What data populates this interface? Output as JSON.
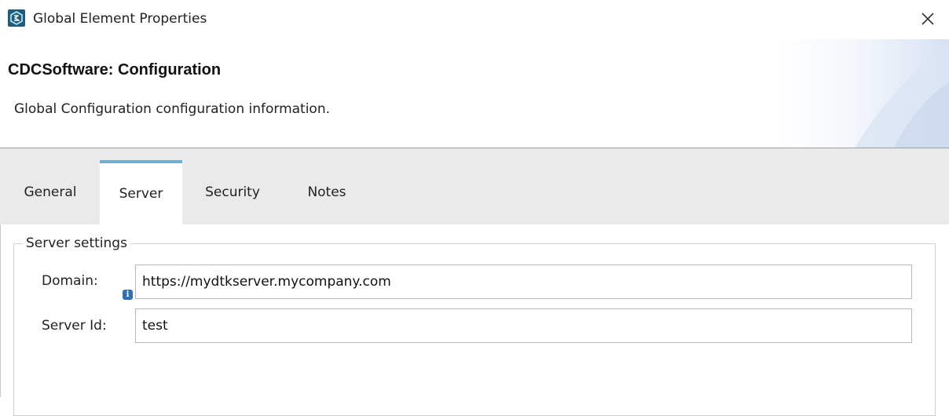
{
  "window": {
    "title": "Global Element Properties",
    "icon": "app-logo-icon",
    "close_icon": "close-icon"
  },
  "header": {
    "title": "CDCSoftware: Configuration",
    "description": "Global Configuration configuration information."
  },
  "tabs": [
    {
      "label": "General",
      "active": false
    },
    {
      "label": "Server",
      "active": true
    },
    {
      "label": "Security",
      "active": false
    },
    {
      "label": "Notes",
      "active": false
    }
  ],
  "server_settings": {
    "legend": "Server settings",
    "domain": {
      "label": "Domain:",
      "value": "https://mydtkserver.mycompany.com",
      "info_icon": "info-icon"
    },
    "server_id": {
      "label": "Server Id:",
      "value": "test"
    }
  },
  "colors": {
    "active_tab_accent": "#6fb0d2",
    "tabstrip_bg": "#eaeaea",
    "logo_bg": "#1f5d7a",
    "info_icon": "#2f6fb3"
  }
}
